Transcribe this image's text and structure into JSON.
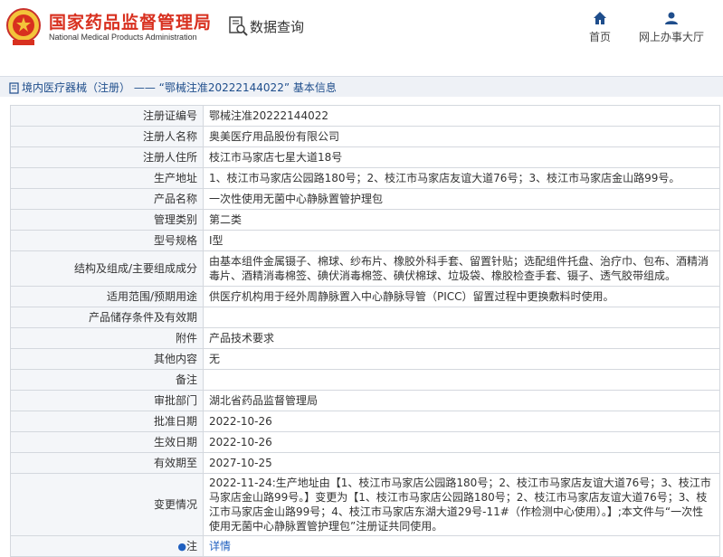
{
  "header": {
    "cn_title": "国家药品监督管理局",
    "en_title": "National Medical Products Administration",
    "search_title": "数据查询",
    "nav": {
      "home": "首页",
      "office": "网上办事大厅"
    }
  },
  "breadcrumb": {
    "text": "境内医疗器械（注册） —— “鄂械注准20222144022” 基本信息"
  },
  "rows": [
    {
      "label": "注册证编号",
      "value": "鄂械注准20222144022"
    },
    {
      "label": "注册人名称",
      "value": "奥美医疗用品股份有限公司"
    },
    {
      "label": "注册人住所",
      "value": "枝江市马家店七星大道18号"
    },
    {
      "label": "生产地址",
      "value": "1、枝江市马家店公园路180号；2、枝江市马家店友谊大道76号；3、枝江市马家店金山路99号。"
    },
    {
      "label": "产品名称",
      "value": "一次性使用无菌中心静脉置管护理包"
    },
    {
      "label": "管理类别",
      "value": "第二类"
    },
    {
      "label": "型号规格",
      "value": "Ⅰ型"
    },
    {
      "label": "结构及组成/主要组成成分",
      "value": "由基本组件金属镊子、棉球、纱布片、橡胶外科手套、留置针贴；选配组件托盘、治疗巾、包布、酒精消毒片、酒精消毒棉签、碘伏消毒棉签、碘伏棉球、垃圾袋、橡胶检查手套、镊子、透气胶带组成。"
    },
    {
      "label": "适用范围/预期用途",
      "value": "供医疗机构用于经外周静脉置入中心静脉导管（PICC）留置过程中更换敷料时使用。"
    },
    {
      "label": "产品储存条件及有效期",
      "value": ""
    },
    {
      "label": "附件",
      "value": "产品技术要求"
    },
    {
      "label": "其他内容",
      "value": "无"
    },
    {
      "label": "备注",
      "value": ""
    },
    {
      "label": "审批部门",
      "value": "湖北省药品监督管理局"
    },
    {
      "label": "批准日期",
      "value": "2022-10-26"
    },
    {
      "label": "生效日期",
      "value": "2022-10-26"
    },
    {
      "label": "有效期至",
      "value": "2027-10-25"
    },
    {
      "label": "变更情况",
      "value": "2022-11-24:生产地址由【1、枝江市马家店公园路180号；2、枝江市马家店友谊大道76号；3、枝江市马家店金山路99号。】变更为【1、枝江市马家店公园路180号；2、枝江市马家店友谊大道76号；3、枝江市马家店金山路99号；4、枝江市马家店东湖大道29号-11#（作检测中心使用）。】;本文件与“一次性使用无菌中心静脉置管护理包”注册证共同使用。"
    },
    {
      "label": "注",
      "value": "详情"
    }
  ],
  "icons": {
    "logo": "national-emblem",
    "search": "document-search-icon",
    "home": "home-icon",
    "office": "user-icon",
    "breadcrumb": "document-icon",
    "note": "location-pin-icon"
  },
  "colors": {
    "brand_red": "#d8301f",
    "link_blue": "#1f5fbf",
    "nav_blue": "#1f4e8c"
  }
}
